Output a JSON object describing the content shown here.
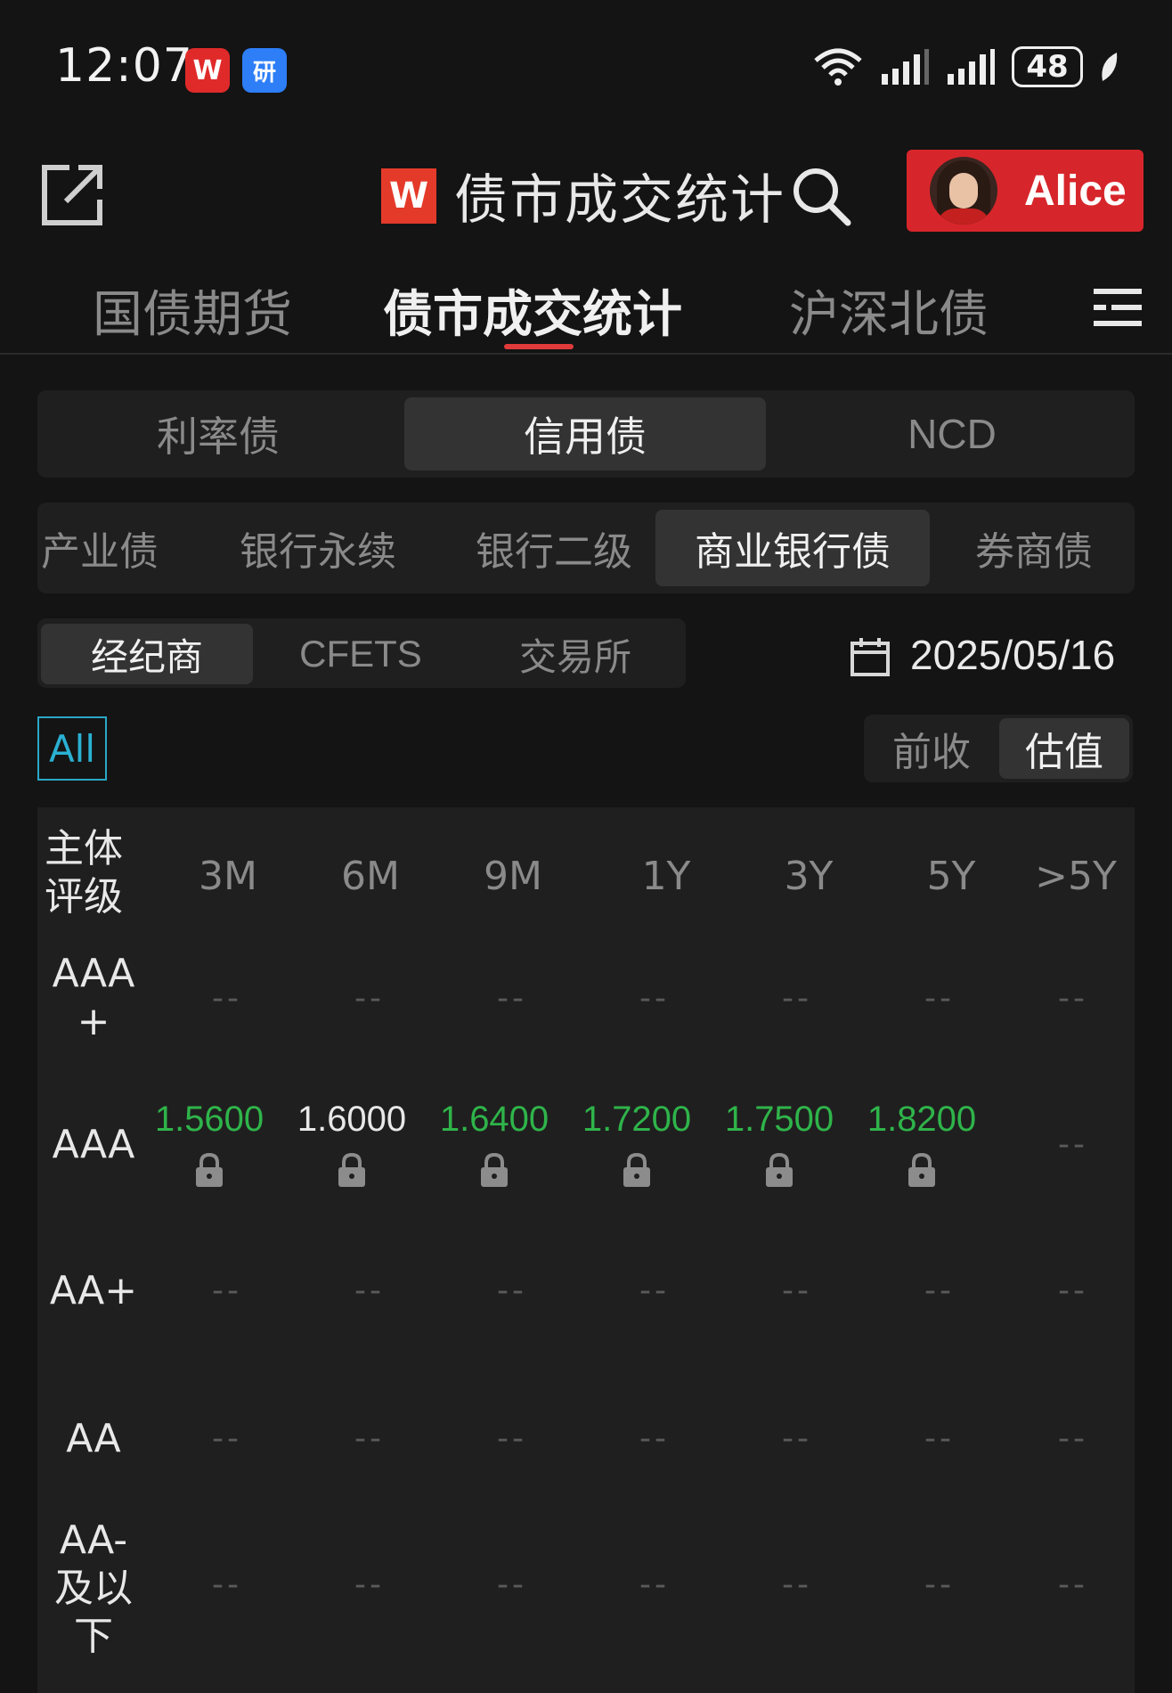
{
  "status_bar": {
    "time": "12:07",
    "app_icons": [
      "W",
      "研"
    ],
    "battery": "48"
  },
  "header": {
    "title_logo": "W",
    "title": "债市成交统计",
    "user_name": "Alice"
  },
  "nav_tabs": [
    {
      "label": "国债期货",
      "active": false
    },
    {
      "label": "债市成交统计",
      "active": true
    },
    {
      "label": "沪深北债",
      "active": false
    }
  ],
  "bond_type_tabs": [
    {
      "label": "利率债",
      "active": false
    },
    {
      "label": "信用债",
      "active": true
    },
    {
      "label": "NCD",
      "active": false
    }
  ],
  "bond_subtype_tabs": [
    {
      "label": "产业债",
      "active": false
    },
    {
      "label": "银行永续",
      "active": false
    },
    {
      "label": "银行二级",
      "active": false
    },
    {
      "label": "商业银行债",
      "active": true
    },
    {
      "label": "券商债",
      "active": false
    }
  ],
  "source_tabs": [
    {
      "label": "经纪商",
      "active": true
    },
    {
      "label": "CFETS",
      "active": false
    },
    {
      "label": "交易所",
      "active": false
    }
  ],
  "date": "2025/05/16",
  "filter": "All",
  "price_tabs": [
    {
      "label": "前收",
      "active": false
    },
    {
      "label": "估值",
      "active": true
    }
  ],
  "table": {
    "rating_header": [
      "主体",
      "评级"
    ],
    "columns": [
      "3M",
      "6M",
      "9M",
      "1Y",
      "3Y",
      "5Y",
      ">5Y"
    ],
    "rows": [
      {
        "rating": [
          "AAA",
          "+"
        ],
        "cells": [
          "--",
          "--",
          "--",
          "--",
          "--",
          "--",
          "--"
        ]
      },
      {
        "rating": [
          "AAA"
        ],
        "cells": [
          "1.5600",
          "1.6000",
          "1.6400",
          "1.7200",
          "1.7500",
          "1.8200",
          "--"
        ],
        "colors": [
          "green",
          "white",
          "green",
          "green",
          "green",
          "green",
          ""
        ],
        "locked": [
          true,
          true,
          true,
          true,
          true,
          true,
          false
        ]
      },
      {
        "rating": [
          "AA+"
        ],
        "cells": [
          "--",
          "--",
          "--",
          "--",
          "--",
          "--",
          "--"
        ]
      },
      {
        "rating": [
          "AA"
        ],
        "cells": [
          "--",
          "--",
          "--",
          "--",
          "--",
          "--",
          "--"
        ]
      },
      {
        "rating": [
          "AA-",
          "及以",
          "下"
        ],
        "cells": [
          "--",
          "--",
          "--",
          "--",
          "--",
          "--",
          "--"
        ]
      }
    ]
  },
  "colors": {
    "accent_red": "#d7262b",
    "positive_green": "#2fb44a",
    "filter_blue": "#2ab0d2"
  }
}
